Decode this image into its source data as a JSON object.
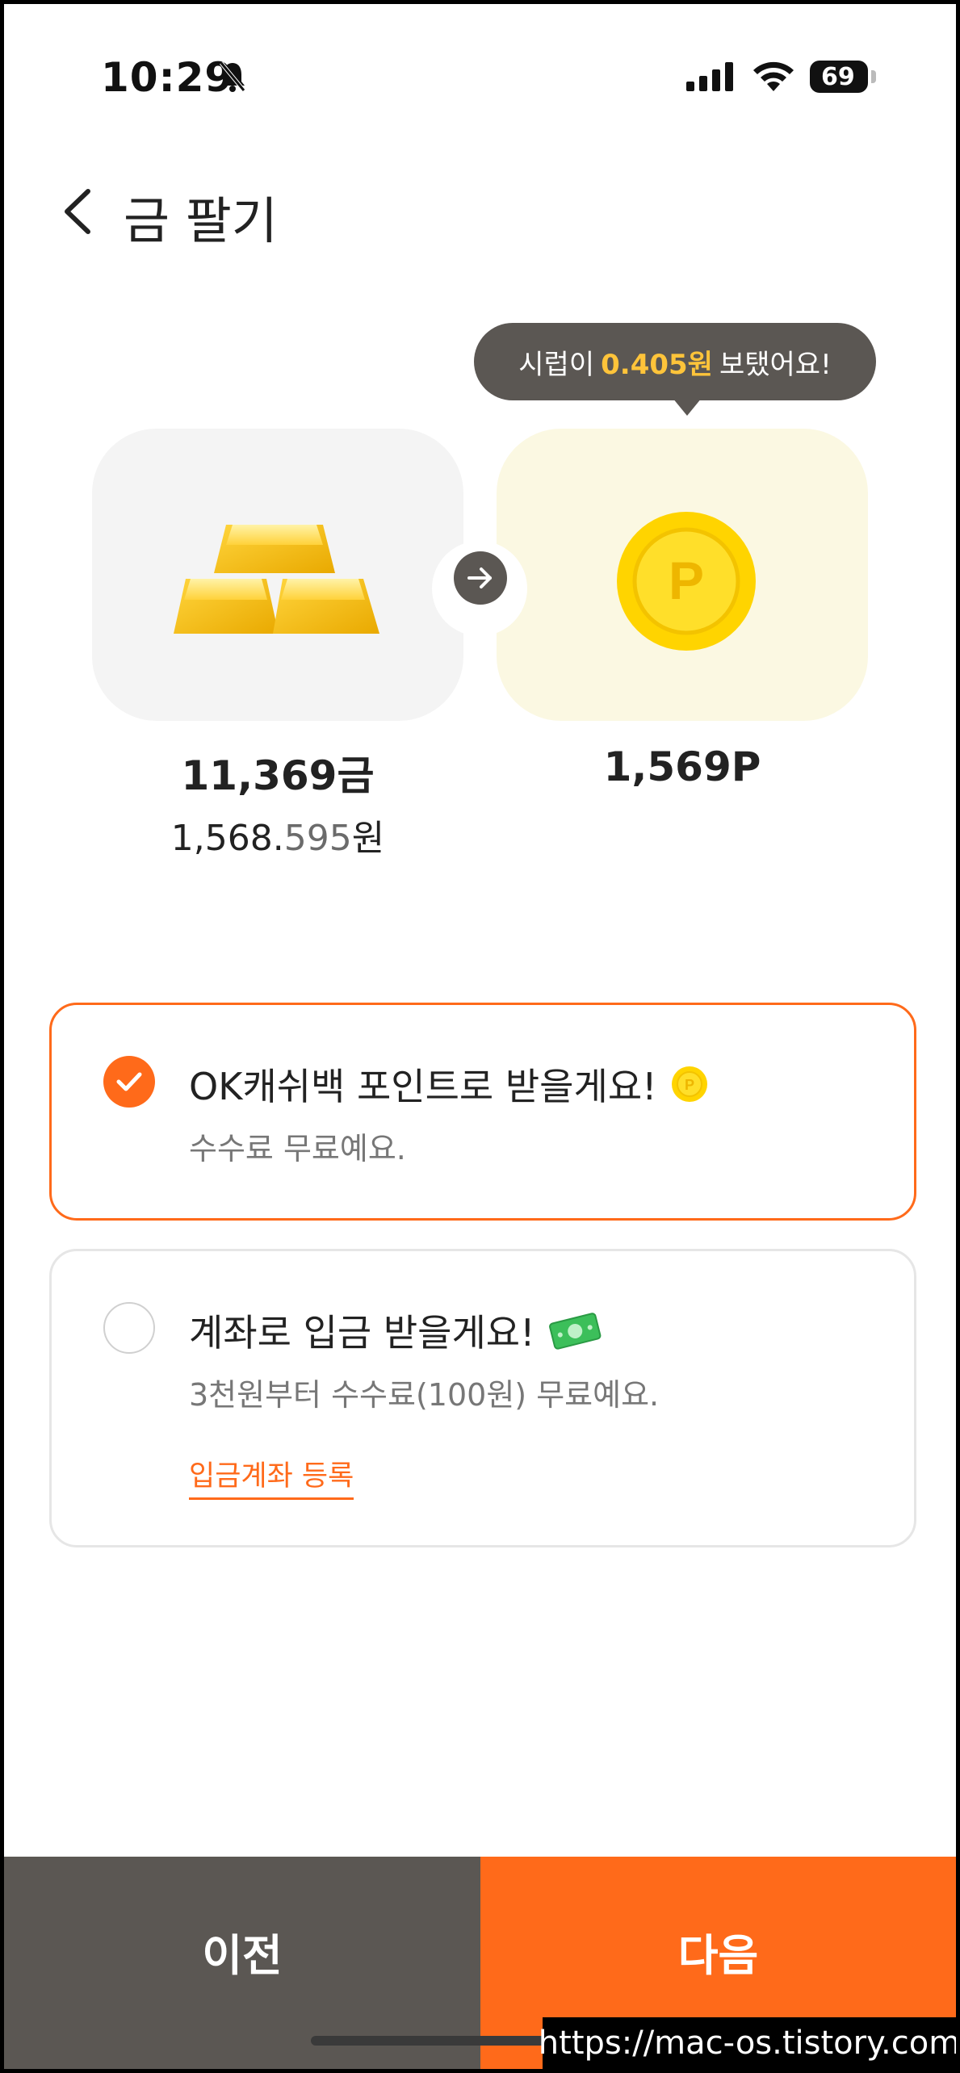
{
  "status_bar": {
    "time": "10:29",
    "battery": "69"
  },
  "header": {
    "title": "금 팔기"
  },
  "tooltip": {
    "prefix": "시럽이",
    "highlight": "0.405원",
    "suffix": "보탰어요!"
  },
  "gold": {
    "amount": "11,369금",
    "won_int": "1,568.",
    "won_dec": "595",
    "won_unit": "원"
  },
  "point": {
    "amount": "1,569P",
    "coin_letter": "P"
  },
  "options": [
    {
      "title": "OK캐쉬백 포인트로 받을게요!",
      "subtitle": "수수료 무료예요.",
      "selected": true
    },
    {
      "title": "계좌로 입금 받을게요!",
      "subtitle": "3천원부터 수수료(100원) 무료예요.",
      "link": "입금계좌 등록",
      "selected": false
    }
  ],
  "buttons": {
    "prev": "이전",
    "next": "다음"
  },
  "watermark": "https://mac-os.tistory.com",
  "colors": {
    "accent": "#ff6a1a",
    "dark": "#5b5753",
    "highlight": "#ffc43a"
  }
}
